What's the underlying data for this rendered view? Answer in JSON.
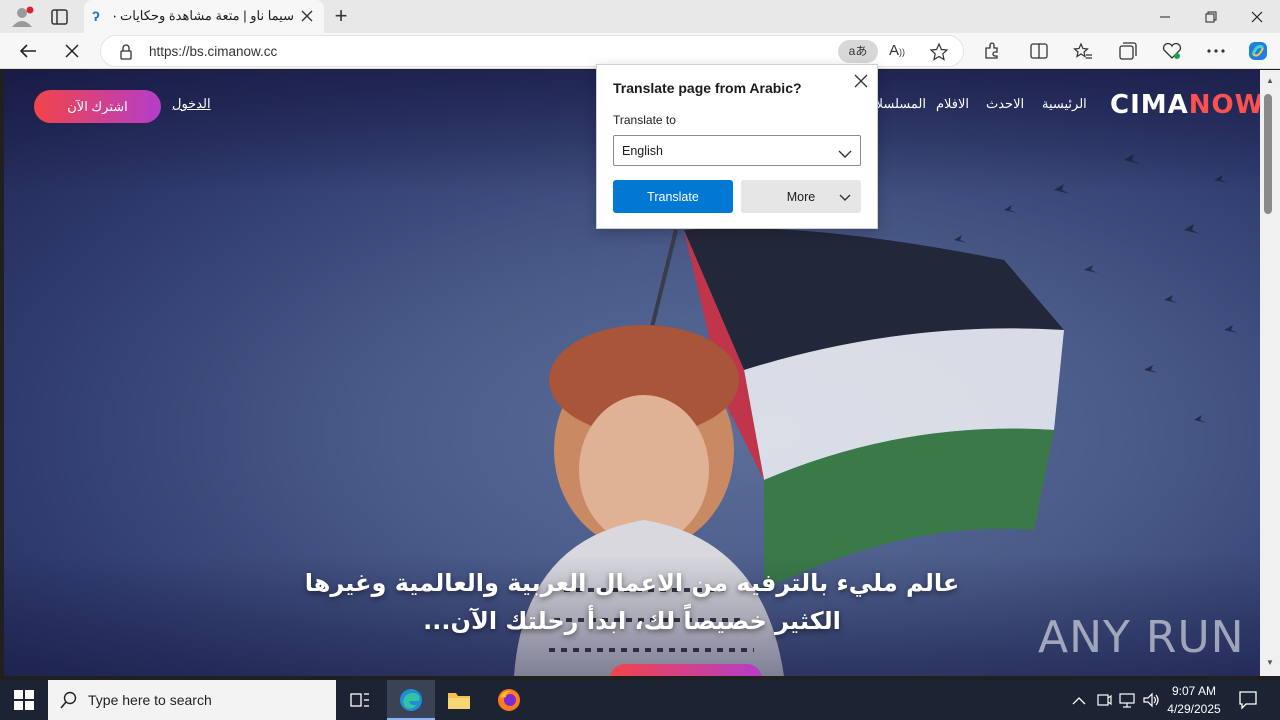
{
  "browser": {
    "tab_title": "سيما ناو | متعة مشاهدة وحكايات جديدة",
    "new_tab_symbol": "+",
    "url": "https://bs.cimanow.cc",
    "translate_icon_text": "aあ"
  },
  "site": {
    "logo_text_a": "CIMA",
    "logo_text_b": "NOW",
    "nav": [
      "الرئيسية",
      "الاحدث",
      "الافلام",
      "المسلسلات"
    ],
    "login": "الدخول",
    "subscribe": "اشترك الآن",
    "hero_line1": "عالم مليء بالترفيه من الاعمال العربية والعالمية وغيرها",
    "hero_line2": "الكثير خصيصاً لك، ابدأ رحلتك الآن...",
    "watermark": "ANY RUN"
  },
  "translate_popup": {
    "title": "Translate page from Arabic?",
    "label": "Translate to",
    "selected_language": "English",
    "translate_button": "Translate",
    "more_button": "More"
  },
  "taskbar": {
    "search_placeholder": "Type here to search",
    "time": "9:07 AM",
    "date": "4/29/2025"
  },
  "colors": {
    "accent": "#0078d4",
    "cta_start": "#f2444a",
    "cta_end": "#b23ec9"
  }
}
